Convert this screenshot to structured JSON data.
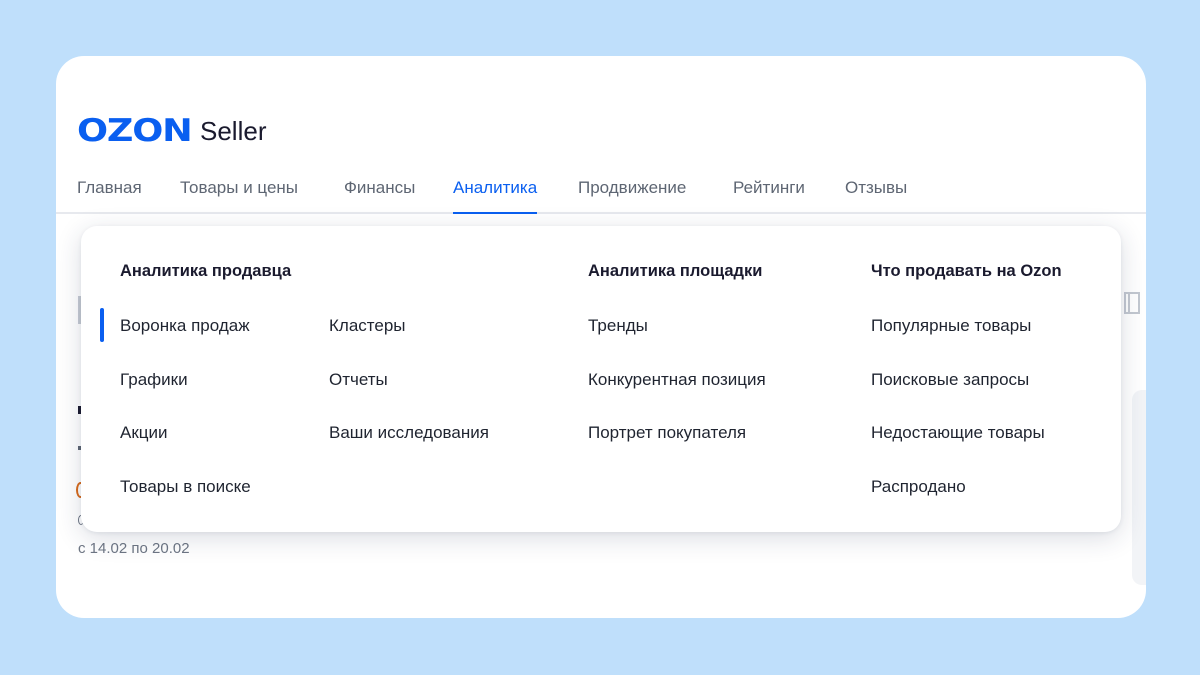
{
  "logo": {
    "mark": "OZON",
    "product": "Seller",
    "brand_color": "#0a5ff0"
  },
  "nav": {
    "tabs": [
      {
        "label": "Главная"
      },
      {
        "label": "Товары и цены"
      },
      {
        "label": "Финансы"
      },
      {
        "label": "Аналитика",
        "active": true
      },
      {
        "label": "Продвижение"
      },
      {
        "label": "Рейтинги"
      },
      {
        "label": "Отзывы"
      }
    ]
  },
  "dropdown": {
    "seller_analytics": {
      "title": "Аналитика продавца",
      "items_col1": [
        "Воронка продаж",
        "Графики",
        "Акции",
        "Товары в поиске"
      ],
      "items_col2": [
        "Кластеры",
        "Отчеты",
        "Ваши исследования"
      ],
      "active_item": "Воронка продаж"
    },
    "platform_analytics": {
      "title": "Аналитика площадки",
      "items": [
        "Тренды",
        "Конкурентная позиция",
        "Портрет покупателя"
      ]
    },
    "what_to_sell": {
      "title": "Что продавать на Ozon",
      "items": [
        "Популярные товары",
        "Поисковые запросы",
        "Недостающие товары",
        "Распродано"
      ]
    }
  },
  "background": {
    "date_range": "с 14.02 по 20.02"
  },
  "colors": {
    "accent": "#0a5ff0",
    "page_bg": "#bfdffb",
    "text": "#1f2430",
    "muted": "#5e6673"
  }
}
